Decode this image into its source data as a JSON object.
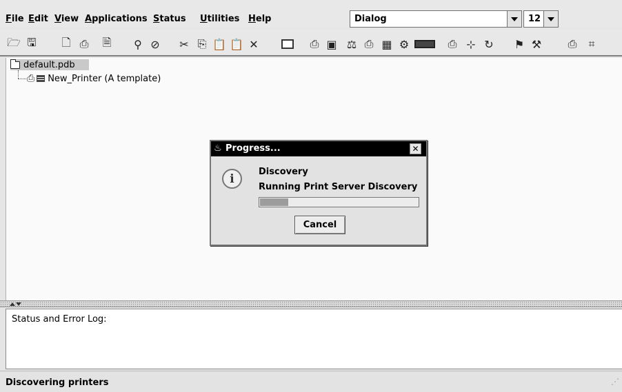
{
  "menubar": {
    "items": [
      {
        "label": "File",
        "mnemonic": "F",
        "rest": "ile"
      },
      {
        "label": "Edit",
        "mnemonic": "E",
        "rest": "dit"
      },
      {
        "label": "View",
        "mnemonic": "V",
        "rest": "iew"
      },
      {
        "label": "Applications",
        "mnemonic": "A",
        "rest": "pplications"
      },
      {
        "label": "Status",
        "mnemonic": "S",
        "rest": "tatus"
      },
      {
        "label": "Utilities",
        "mnemonic": "U",
        "rest": "tilities"
      },
      {
        "label": "Help",
        "mnemonic": "H",
        "rest": "elp"
      }
    ],
    "font_combo": "Dialog",
    "size_combo": "12"
  },
  "toolbar": {
    "icons": [
      "open-folder-icon",
      "save-icon",
      "new-printer-icon",
      "add-printer-icon",
      "new-document-icon",
      "find-icon",
      "stop-icon",
      "cut-icon",
      "copy-icon",
      "paste-icon",
      "paste-special-icon",
      "delete-icon",
      "keyboard-icon",
      "printer-properties-icon",
      "script-icon",
      "scale-icon",
      "discover-icon",
      "monitor-icon",
      "config-icon",
      "bar-icon",
      "printer-status-icon",
      "merge-icon",
      "refresh-icon",
      "flag-icon",
      "tools-icon",
      "printer-id-icon",
      "id-icon"
    ]
  },
  "tree": {
    "root": "default.pdb",
    "child": "New_Printer (A template)"
  },
  "log": {
    "label": "Status and Error Log:"
  },
  "status": {
    "text": "Discovering printers"
  },
  "dialog": {
    "title": "Progress...",
    "close": "✕",
    "message_title": "Discovery",
    "message": "Running Print Server Discovery",
    "progress": 0.18,
    "cancel_label": "Cancel"
  }
}
